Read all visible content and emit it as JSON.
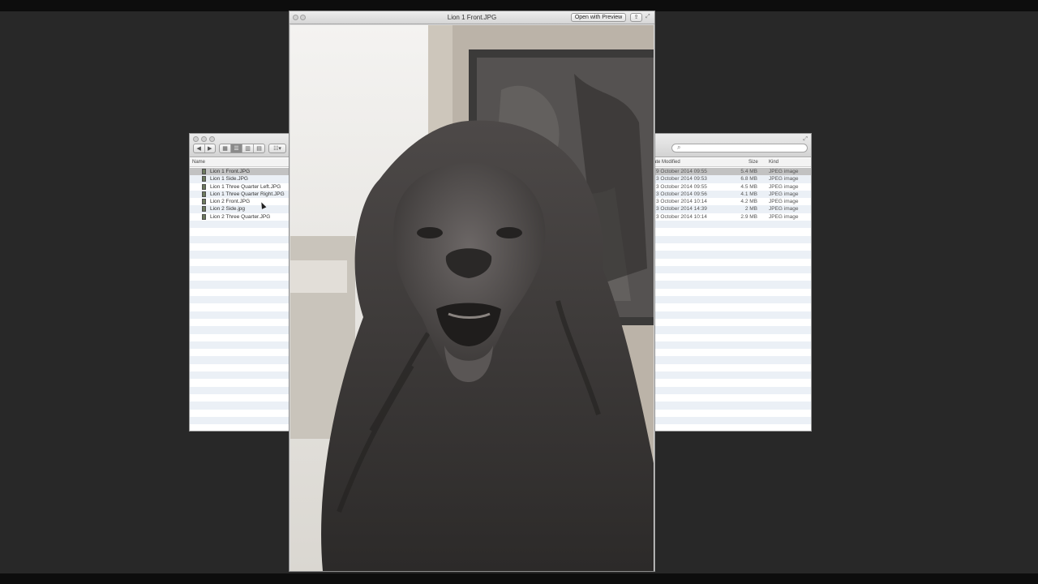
{
  "finder": {
    "columns": {
      "name": "Name",
      "date_modified": "ate Modified",
      "size": "Size",
      "kind": "Kind"
    },
    "search_icon": "search-icon",
    "files": [
      {
        "name": "Lion 1 Front.JPG",
        "date": "9 October 2014 09:55",
        "size": "5.4 MB",
        "kind": "JPEG image",
        "selected": true
      },
      {
        "name": "Lion 1 Side.JPG",
        "date": "3 October 2014 09:53",
        "size": "6.8 MB",
        "kind": "JPEG image"
      },
      {
        "name": "Lion 1 Three Quarter Left.JPG",
        "date": "3 October 2014 09:55",
        "size": "4.5 MB",
        "kind": "JPEG image"
      },
      {
        "name": "Lion 1 Three Quarter Right.JPG",
        "date": "3 October 2014 09:56",
        "size": "4.1 MB",
        "kind": "JPEG image"
      },
      {
        "name": "Lion 2 Front.JPG",
        "date": "3 October 2014 10:14",
        "size": "4.2 MB",
        "kind": "JPEG image"
      },
      {
        "name": "Lion 2 Side.jpg",
        "date": "3 October 2014 14:39",
        "size": "2 MB",
        "kind": "JPEG image"
      },
      {
        "name": "Lion 2 Three Quarter.JPG",
        "date": "3 October 2014 10:14",
        "size": "2.9 MB",
        "kind": "JPEG image"
      }
    ],
    "empty_rows": 27
  },
  "quicklook": {
    "title": "Lion 1 Front.JPG",
    "open_with_label": "Open with Preview",
    "share_icon": "share-icon",
    "fullscreen_icon": "fullscreen-icon"
  },
  "colors": {
    "desktop": "#282828",
    "selection": "#c2c2c2",
    "row_alt": "#ebf0f6"
  }
}
